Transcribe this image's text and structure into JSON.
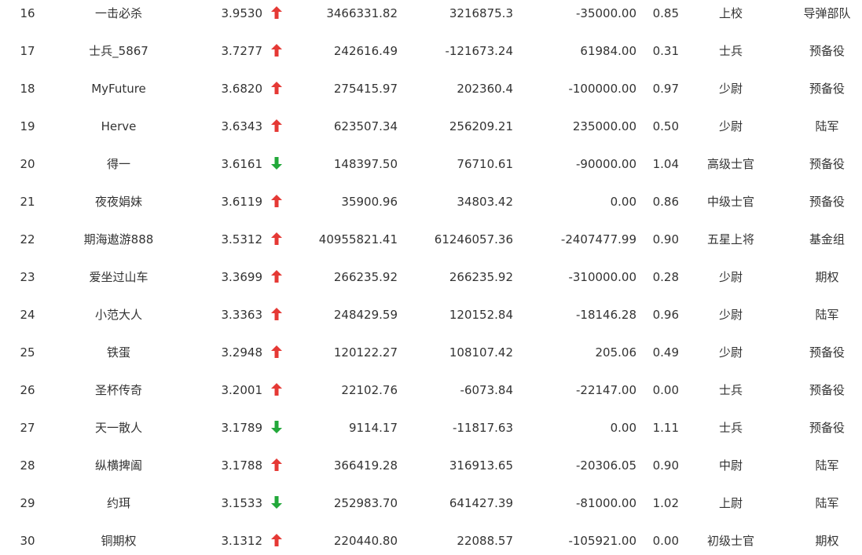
{
  "colors": {
    "up": "#e53935",
    "down": "#22a83a",
    "text": "#333333"
  },
  "rows": [
    {
      "rank": "16",
      "name": "一击必杀",
      "score": "3.9530",
      "trend": "up",
      "v1": "3466331.82",
      "v2": "3216875.3",
      "v3": "-35000.00",
      "ratio": "0.85",
      "title": "上校",
      "group": "导弹部队"
    },
    {
      "rank": "17",
      "name": "士兵_5867",
      "score": "3.7277",
      "trend": "up",
      "v1": "242616.49",
      "v2": "-121673.24",
      "v3": "61984.00",
      "ratio": "0.31",
      "title": "士兵",
      "group": "预备役"
    },
    {
      "rank": "18",
      "name": "MyFuture",
      "score": "3.6820",
      "trend": "up",
      "v1": "275415.97",
      "v2": "202360.4",
      "v3": "-100000.00",
      "ratio": "0.97",
      "title": "少尉",
      "group": "预备役"
    },
    {
      "rank": "19",
      "name": "Herve",
      "score": "3.6343",
      "trend": "up",
      "v1": "623507.34",
      "v2": "256209.21",
      "v3": "235000.00",
      "ratio": "0.50",
      "title": "少尉",
      "group": "陆军"
    },
    {
      "rank": "20",
      "name": "得一",
      "score": "3.6161",
      "trend": "down",
      "v1": "148397.50",
      "v2": "76710.61",
      "v3": "-90000.00",
      "ratio": "1.04",
      "title": "高级士官",
      "group": "预备役"
    },
    {
      "rank": "21",
      "name": "夜夜娟妹",
      "score": "3.6119",
      "trend": "up",
      "v1": "35900.96",
      "v2": "34803.42",
      "v3": "0.00",
      "ratio": "0.86",
      "title": "中级士官",
      "group": "预备役"
    },
    {
      "rank": "22",
      "name": "期海遨游888",
      "score": "3.5312",
      "trend": "up",
      "v1": "40955821.41",
      "v2": "61246057.36",
      "v3": "-2407477.99",
      "ratio": "0.90",
      "title": "五星上将",
      "group": "基金组"
    },
    {
      "rank": "23",
      "name": "爱坐过山车",
      "score": "3.3699",
      "trend": "up",
      "v1": "266235.92",
      "v2": "266235.92",
      "v3": "-310000.00",
      "ratio": "0.28",
      "title": "少尉",
      "group": "期权"
    },
    {
      "rank": "24",
      "name": "小范大人",
      "score": "3.3363",
      "trend": "up",
      "v1": "248429.59",
      "v2": "120152.84",
      "v3": "-18146.28",
      "ratio": "0.96",
      "title": "少尉",
      "group": "陆军"
    },
    {
      "rank": "25",
      "name": "铁蛋",
      "score": "3.2948",
      "trend": "up",
      "v1": "120122.27",
      "v2": "108107.42",
      "v3": "205.06",
      "ratio": "0.49",
      "title": "少尉",
      "group": "预备役"
    },
    {
      "rank": "26",
      "name": "圣杯传奇",
      "score": "3.2001",
      "trend": "up",
      "v1": "22102.76",
      "v2": "-6073.84",
      "v3": "-22147.00",
      "ratio": "0.00",
      "title": "士兵",
      "group": "预备役"
    },
    {
      "rank": "27",
      "name": "天一散人",
      "score": "3.1789",
      "trend": "down",
      "v1": "9114.17",
      "v2": "-11817.63",
      "v3": "0.00",
      "ratio": "1.11",
      "title": "士兵",
      "group": "预备役"
    },
    {
      "rank": "28",
      "name": "纵横捭阖",
      "score": "3.1788",
      "trend": "up",
      "v1": "366419.28",
      "v2": "316913.65",
      "v3": "-20306.05",
      "ratio": "0.90",
      "title": "中尉",
      "group": "陆军"
    },
    {
      "rank": "29",
      "name": "约珥",
      "score": "3.1533",
      "trend": "down",
      "v1": "252983.70",
      "v2": "641427.39",
      "v3": "-81000.00",
      "ratio": "1.02",
      "title": "上尉",
      "group": "陆军"
    },
    {
      "rank": "30",
      "name": "铜期权",
      "score": "3.1312",
      "trend": "up",
      "v1": "220440.80",
      "v2": "22088.57",
      "v3": "-105921.00",
      "ratio": "0.00",
      "title": "初级士官",
      "group": "期权"
    }
  ]
}
